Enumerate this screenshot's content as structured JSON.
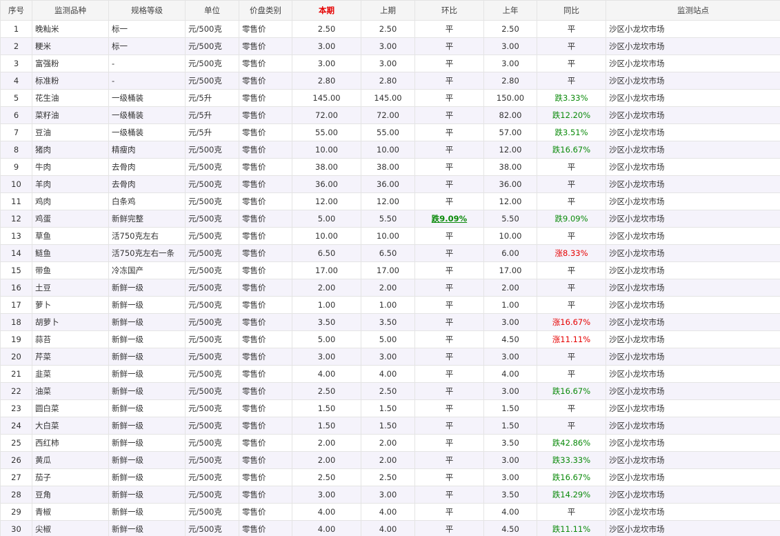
{
  "table": {
    "headers": {
      "seq": "序号",
      "item": "监测品种",
      "grade": "规格等级",
      "unit": "单位",
      "price_type": "价盘类别",
      "current": "本期",
      "previous": "上期",
      "mom": "环比",
      "last_year": "上年",
      "yoy": "同比",
      "station": "监测站点"
    },
    "rows": [
      {
        "seq": "1",
        "item": "晚籼米",
        "grade": "标一",
        "unit": "元/500克",
        "type": "零售价",
        "current": "2.50",
        "previous": "2.50",
        "mom": "平",
        "last_year": "2.50",
        "yoy": "平",
        "station": "沙区小龙坎市场"
      },
      {
        "seq": "2",
        "item": "粳米",
        "grade": "标一",
        "unit": "元/500克",
        "type": "零售价",
        "current": "3.00",
        "previous": "3.00",
        "mom": "平",
        "last_year": "3.00",
        "yoy": "平",
        "station": "沙区小龙坎市场"
      },
      {
        "seq": "3",
        "item": "富强粉",
        "grade": "-",
        "unit": "元/500克",
        "type": "零售价",
        "current": "3.00",
        "previous": "3.00",
        "mom": "平",
        "last_year": "3.00",
        "yoy": "平",
        "station": "沙区小龙坎市场"
      },
      {
        "seq": "4",
        "item": "标准粉",
        "grade": "-",
        "unit": "元/500克",
        "type": "零售价",
        "current": "2.80",
        "previous": "2.80",
        "mom": "平",
        "last_year": "2.80",
        "yoy": "平",
        "station": "沙区小龙坎市场"
      },
      {
        "seq": "5",
        "item": "花生油",
        "grade": "一级桶装",
        "unit": "元/5升",
        "type": "零售价",
        "current": "145.00",
        "previous": "145.00",
        "mom": "平",
        "last_year": "150.00",
        "yoy": "跌3.33%",
        "station": "沙区小龙坎市场"
      },
      {
        "seq": "6",
        "item": "菜籽油",
        "grade": "一级桶装",
        "unit": "元/5升",
        "type": "零售价",
        "current": "72.00",
        "previous": "72.00",
        "mom": "平",
        "last_year": "82.00",
        "yoy": "跌12.20%",
        "station": "沙区小龙坎市场"
      },
      {
        "seq": "7",
        "item": "豆油",
        "grade": "一级桶装",
        "unit": "元/5升",
        "type": "零售价",
        "current": "55.00",
        "previous": "55.00",
        "mom": "平",
        "last_year": "57.00",
        "yoy": "跌3.51%",
        "station": "沙区小龙坎市场"
      },
      {
        "seq": "8",
        "item": "猪肉",
        "grade": "精瘦肉",
        "unit": "元/500克",
        "type": "零售价",
        "current": "10.00",
        "previous": "10.00",
        "mom": "平",
        "last_year": "12.00",
        "yoy": "跌16.67%",
        "station": "沙区小龙坎市场"
      },
      {
        "seq": "9",
        "item": "牛肉",
        "grade": "去骨肉",
        "unit": "元/500克",
        "type": "零售价",
        "current": "38.00",
        "previous": "38.00",
        "mom": "平",
        "last_year": "38.00",
        "yoy": "平",
        "station": "沙区小龙坎市场"
      },
      {
        "seq": "10",
        "item": "羊肉",
        "grade": "去骨肉",
        "unit": "元/500克",
        "type": "零售价",
        "current": "36.00",
        "previous": "36.00",
        "mom": "平",
        "last_year": "36.00",
        "yoy": "平",
        "station": "沙区小龙坎市场"
      },
      {
        "seq": "11",
        "item": "鸡肉",
        "grade": "白条鸡",
        "unit": "元/500克",
        "type": "零售价",
        "current": "12.00",
        "previous": "12.00",
        "mom": "平",
        "last_year": "12.00",
        "yoy": "平",
        "station": "沙区小龙坎市场"
      },
      {
        "seq": "12",
        "item": "鸡蛋",
        "grade": "新鲜完整",
        "unit": "元/500克",
        "type": "零售价",
        "current": "5.00",
        "previous": "5.50",
        "mom": "跌9.09%",
        "last_year": "5.50",
        "yoy": "跌9.09%",
        "station": "沙区小龙坎市场"
      },
      {
        "seq": "13",
        "item": "草鱼",
        "grade": "活750克左右",
        "unit": "元/500克",
        "type": "零售价",
        "current": "10.00",
        "previous": "10.00",
        "mom": "平",
        "last_year": "10.00",
        "yoy": "平",
        "station": "沙区小龙坎市场"
      },
      {
        "seq": "14",
        "item": "鲢鱼",
        "grade": "活750克左右一条",
        "unit": "元/500克",
        "type": "零售价",
        "current": "6.50",
        "previous": "6.50",
        "mom": "平",
        "last_year": "6.00",
        "yoy": "涨8.33%",
        "station": "沙区小龙坎市场"
      },
      {
        "seq": "15",
        "item": "带鱼",
        "grade": "冷冻国产",
        "unit": "元/500克",
        "type": "零售价",
        "current": "17.00",
        "previous": "17.00",
        "mom": "平",
        "last_year": "17.00",
        "yoy": "平",
        "station": "沙区小龙坎市场"
      },
      {
        "seq": "16",
        "item": "土豆",
        "grade": "新鲜一级",
        "unit": "元/500克",
        "type": "零售价",
        "current": "2.00",
        "previous": "2.00",
        "mom": "平",
        "last_year": "2.00",
        "yoy": "平",
        "station": "沙区小龙坎市场"
      },
      {
        "seq": "17",
        "item": "萝卜",
        "grade": "新鲜一级",
        "unit": "元/500克",
        "type": "零售价",
        "current": "1.00",
        "previous": "1.00",
        "mom": "平",
        "last_year": "1.00",
        "yoy": "平",
        "station": "沙区小龙坎市场"
      },
      {
        "seq": "18",
        "item": "胡萝卜",
        "grade": "新鲜一级",
        "unit": "元/500克",
        "type": "零售价",
        "current": "3.50",
        "previous": "3.50",
        "mom": "平",
        "last_year": "3.00",
        "yoy": "涨16.67%",
        "station": "沙区小龙坎市场"
      },
      {
        "seq": "19",
        "item": "蒜苔",
        "grade": "新鲜一级",
        "unit": "元/500克",
        "type": "零售价",
        "current": "5.00",
        "previous": "5.00",
        "mom": "平",
        "last_year": "4.50",
        "yoy": "涨11.11%",
        "station": "沙区小龙坎市场"
      },
      {
        "seq": "20",
        "item": "芹菜",
        "grade": "新鲜一级",
        "unit": "元/500克",
        "type": "零售价",
        "current": "3.00",
        "previous": "3.00",
        "mom": "平",
        "last_year": "3.00",
        "yoy": "平",
        "station": "沙区小龙坎市场"
      },
      {
        "seq": "21",
        "item": "韭菜",
        "grade": "新鲜一级",
        "unit": "元/500克",
        "type": "零售价",
        "current": "4.00",
        "previous": "4.00",
        "mom": "平",
        "last_year": "4.00",
        "yoy": "平",
        "station": "沙区小龙坎市场"
      },
      {
        "seq": "22",
        "item": "油菜",
        "grade": "新鲜一级",
        "unit": "元/500克",
        "type": "零售价",
        "current": "2.50",
        "previous": "2.50",
        "mom": "平",
        "last_year": "3.00",
        "yoy": "跌16.67%",
        "station": "沙区小龙坎市场"
      },
      {
        "seq": "23",
        "item": "圆白菜",
        "grade": "新鲜一级",
        "unit": "元/500克",
        "type": "零售价",
        "current": "1.50",
        "previous": "1.50",
        "mom": "平",
        "last_year": "1.50",
        "yoy": "平",
        "station": "沙区小龙坎市场"
      },
      {
        "seq": "24",
        "item": "大白菜",
        "grade": "新鲜一级",
        "unit": "元/500克",
        "type": "零售价",
        "current": "1.50",
        "previous": "1.50",
        "mom": "平",
        "last_year": "1.50",
        "yoy": "平",
        "station": "沙区小龙坎市场"
      },
      {
        "seq": "25",
        "item": "西红柿",
        "grade": "新鲜一级",
        "unit": "元/500克",
        "type": "零售价",
        "current": "2.00",
        "previous": "2.00",
        "mom": "平",
        "last_year": "3.50",
        "yoy": "跌42.86%",
        "station": "沙区小龙坎市场"
      },
      {
        "seq": "26",
        "item": "黄瓜",
        "grade": "新鲜一级",
        "unit": "元/500克",
        "type": "零售价",
        "current": "2.00",
        "previous": "2.00",
        "mom": "平",
        "last_year": "3.00",
        "yoy": "跌33.33%",
        "station": "沙区小龙坎市场"
      },
      {
        "seq": "27",
        "item": "茄子",
        "grade": "新鲜一级",
        "unit": "元/500克",
        "type": "零售价",
        "current": "2.50",
        "previous": "2.50",
        "mom": "平",
        "last_year": "3.00",
        "yoy": "跌16.67%",
        "station": "沙区小龙坎市场"
      },
      {
        "seq": "28",
        "item": "豆角",
        "grade": "新鲜一级",
        "unit": "元/500克",
        "type": "零售价",
        "current": "3.00",
        "previous": "3.00",
        "mom": "平",
        "last_year": "3.50",
        "yoy": "跌14.29%",
        "station": "沙区小龙坎市场"
      },
      {
        "seq": "29",
        "item": "青椒",
        "grade": "新鲜一级",
        "unit": "元/500克",
        "type": "零售价",
        "current": "4.00",
        "previous": "4.00",
        "mom": "平",
        "last_year": "4.00",
        "yoy": "平",
        "station": "沙区小龙坎市场"
      },
      {
        "seq": "30",
        "item": "尖椒",
        "grade": "新鲜一级",
        "unit": "元/500克",
        "type": "零售价",
        "current": "4.00",
        "previous": "4.00",
        "mom": "平",
        "last_year": "4.50",
        "yoy": "跌11.11%",
        "station": "沙区小龙坎市场"
      }
    ]
  },
  "colors": {
    "up": "#e60000",
    "down": "#0a8a0a",
    "current_header": "#e60000",
    "header_bg": "#f5f5f5",
    "alt_row_bg": "#f5f3fb"
  }
}
